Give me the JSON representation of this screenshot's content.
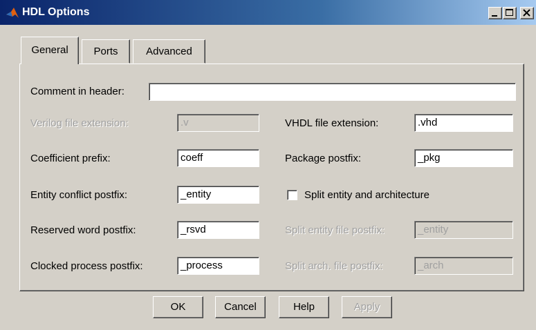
{
  "window": {
    "title": "HDL Options"
  },
  "tabs": [
    {
      "label": "General"
    },
    {
      "label": "Ports"
    },
    {
      "label": "Advanced"
    }
  ],
  "general": {
    "comment_label": "Comment in header:",
    "comment_value": "",
    "verilog_label": "Verilog file extension:",
    "verilog_value": ".v",
    "vhdl_label": "VHDL file extension:",
    "vhdl_value": ".vhd",
    "coeff_label": "Coefficient prefix:",
    "coeff_value": "coeff",
    "package_label": "Package postfix:",
    "package_value": "_pkg",
    "entity_label": "Entity conflict postfix:",
    "entity_value": "_entity",
    "split_label": "Split entity and architecture",
    "split_checked": false,
    "reserved_label": "Reserved word postfix:",
    "reserved_value": "_rsvd",
    "split_entity_label": "Split entity file postfix:",
    "split_entity_value": "_entity",
    "clocked_label": "Clocked process postfix:",
    "clocked_value": "_process",
    "split_arch_label": "Split arch. file postfix:",
    "split_arch_value": "_arch"
  },
  "buttons": {
    "ok": "OK",
    "cancel": "Cancel",
    "help": "Help",
    "apply": "Apply"
  },
  "icons": {
    "app": "matlab-logo-icon",
    "minimize": "minimize-icon",
    "maximize": "maximize-icon",
    "close": "close-icon"
  },
  "colors": {
    "titlebar_start": "#0a246a",
    "titlebar_end": "#a6caf0",
    "face": "#d4d0c8",
    "disabled_text": "#a0a0a0"
  }
}
